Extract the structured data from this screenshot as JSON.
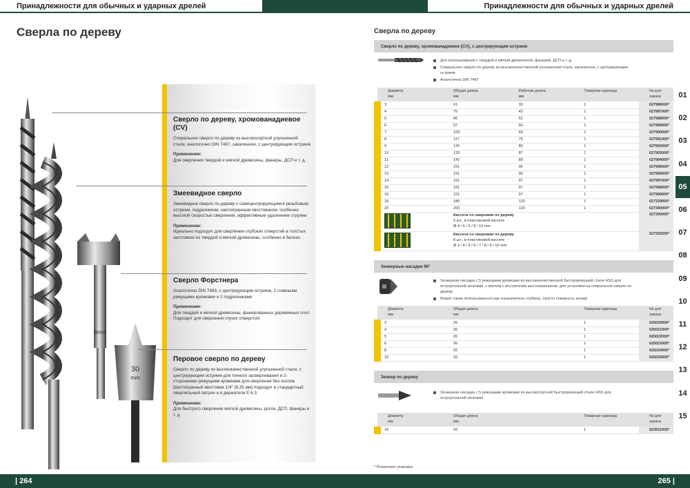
{
  "header": {
    "left_title": "Принадлежности для обычных и ударных дрелей",
    "right_title": "Принадлежности для обычных и ударных дрелей"
  },
  "footer": {
    "left_page": "| 264",
    "right_page": "265 |"
  },
  "left_page": {
    "title": "Сверла по дереву",
    "blocks": [
      {
        "title": "Сверло по дереву, хромованадиевое (CV)",
        "text": "Спиральное сверло по дереву из высокосортной улучшенной стали, аналогично DIN 7487, закаленное, с центрирующим острием",
        "app_label": "Применение:",
        "app_text": "Для сверления твердой и мягкой древесины, фанеры, ДСП и т. д."
      },
      {
        "title": "Змеевидное сверло",
        "text": "Змеевидное сверло по дереву с самоцентрирующимся резьбовым острием, подрезчиком, шестигранным хвостовиком, особенно высокой скоростью сверления, эффективным удалением стружки",
        "app_label": "Применение:",
        "app_text": "Идеально подходит для сверления глубоких отверстий в толстых заготовках из твердой и мягкой древесины, особенно в балках."
      },
      {
        "title": "Сверло Форстнера",
        "text": "Аналогично DIN 7483, с центрирующим острием, 2 главными режущими кромками и 2 подрезчиками",
        "app_label": "Применение:",
        "app_text": "Для твердой и мягкой древесины, фанерованных деревянных плит. Подходит для сверления глухих отверстий."
      },
      {
        "title": "Перовое сверло по дереву",
        "text": "Сверло по дереву из высококачественной улучшенной стали, с центрирующим острием для точного засверливания и 2-сторонними режущими кромками для сверления без сколов. Шестигранный хвостовик 1/4\" (6,35 мм) подходит в стандартный сверлильный патрон и в держатели Е 6.3.",
        "app_label": "Применение:",
        "app_text": "Для быстрого сверления мягкой древесины, досок, ДСП, фанеры и т. д."
      }
    ],
    "spade_label_value": "30",
    "spade_label_unit": "mm",
    "forstner_shank_label": "8mm"
  },
  "right_page": {
    "title": "Сверла по дереву",
    "columns": {
      "diameter": "Диаметр",
      "mm": "мм",
      "total_length": "Общая длина",
      "working_length": "Рабочая длина",
      "unit": "Товарная единица",
      "order_no": "№ для заказа"
    },
    "section1": {
      "head": "Сверло по дереву, хромованадиевое (CV), с центрирующим острием",
      "bullets": [
        "Для использования с твердой и мягкой древесиной, фанерой, ДСП и т. д.",
        "Спиральное сверло по дереву из высококачественной улучшенной стали, закаленное, с центрирующим острием",
        "Аналогично DIN 7487"
      ],
      "rows": [
        {
          "d": "3",
          "total": "61",
          "work": "33",
          "unit": "1",
          "code": "627986000*"
        },
        {
          "d": "4",
          "total": "75",
          "work": "43",
          "unit": "1",
          "code": "627987000*"
        },
        {
          "d": "5",
          "total": "86",
          "work": "52",
          "unit": "1",
          "code": "627988000*"
        },
        {
          "d": "6",
          "total": "97",
          "work": "60",
          "unit": "1",
          "code": "627989000*"
        },
        {
          "d": "7",
          "total": "109",
          "work": "69",
          "unit": "1",
          "code": "627990000*"
        },
        {
          "d": "8",
          "total": "117",
          "work": "75",
          "unit": "1",
          "code": "627991000*"
        },
        {
          "d": "9",
          "total": "125",
          "work": "80",
          "unit": "1",
          "code": "627992000*"
        },
        {
          "d": "10",
          "total": "133",
          "work": "87",
          "unit": "1",
          "code": "627993000*"
        },
        {
          "d": "11",
          "total": "142",
          "work": "89",
          "unit": "1",
          "code": "627994000*"
        },
        {
          "d": "12",
          "total": "151",
          "work": "96",
          "unit": "1",
          "code": "627995000*"
        },
        {
          "d": "13",
          "total": "151",
          "work": "96",
          "unit": "1",
          "code": "627996000*"
        },
        {
          "d": "14",
          "total": "151",
          "work": "97",
          "unit": "1",
          "code": "627997000*"
        },
        {
          "d": "15",
          "total": "151",
          "work": "97",
          "unit": "1",
          "code": "627998000*"
        },
        {
          "d": "16",
          "total": "151",
          "work": "97",
          "unit": "1",
          "code": "627999000*"
        },
        {
          "d": "18",
          "total": "180",
          "work": "120",
          "unit": "1",
          "code": "627339000*"
        },
        {
          "d": "20",
          "total": "200",
          "work": "130",
          "unit": "1",
          "code": "627340000*"
        }
      ],
      "kits": [
        {
          "title": "Кассета со сверлами по дереву",
          "count": "5 шт., в пластиковой кассете",
          "sizes": "Ø 4 / 5 / 6 / 8 / 10 mm",
          "code": "627290000*"
        },
        {
          "title": "Кассета со сверлами по дереву",
          "count": "8 шт., в пластиковой кассете",
          "sizes": "Ø 3 / 4 / 5 / 6 / 7 / 8 / 9 / 10 mm",
          "code": "627292000*"
        }
      ]
    },
    "section2": {
      "head": "Зенкерные насадки 90°",
      "bullets": [
        "Зенкерная насадка с 5 режущими кромками из высококачественной быстрорежущей стали HSS для остроугольной зенковки, с винтом с внутренним шестигранником, для установки на спиральное сверло по дереву",
        "Может также использоваться как ограничитель глубины, просто повернуть зенкер"
      ],
      "rows": [
        {
          "d": "3",
          "total": "26",
          "unit": "1",
          "code": "625020000*"
        },
        {
          "d": "4",
          "total": "26",
          "unit": "1",
          "code": "625021000*"
        },
        {
          "d": "5",
          "total": "26",
          "unit": "1",
          "code": "625022000*"
        },
        {
          "d": "6",
          "total": "26",
          "unit": "1",
          "code": "625023000*"
        },
        {
          "d": "8",
          "total": "26",
          "unit": "1",
          "code": "625024000*"
        },
        {
          "d": "10",
          "total": "26",
          "unit": "1",
          "code": "625025000*"
        }
      ]
    },
    "section3": {
      "head": "Зенкер по дереву",
      "bullets": [
        "Зенкерная насадка с 5 режущими кромками из высокосортной быстрорежущей стали HSS для остроугольной зенковки"
      ],
      "rows": [
        {
          "d": "16",
          "total": "43",
          "unit": "1",
          "code": "623521000*"
        }
      ]
    },
    "footnote": "* Розничная упаковка"
  },
  "tabs": [
    "01",
    "02",
    "03",
    "04",
    "05",
    "06",
    "07",
    "08",
    "09",
    "10",
    "11",
    "12",
    "13",
    "14",
    "15"
  ],
  "active_tab": "05",
  "colors": {
    "brand_green": "#1e4a3e",
    "accent_yellow": "#f2c300"
  }
}
